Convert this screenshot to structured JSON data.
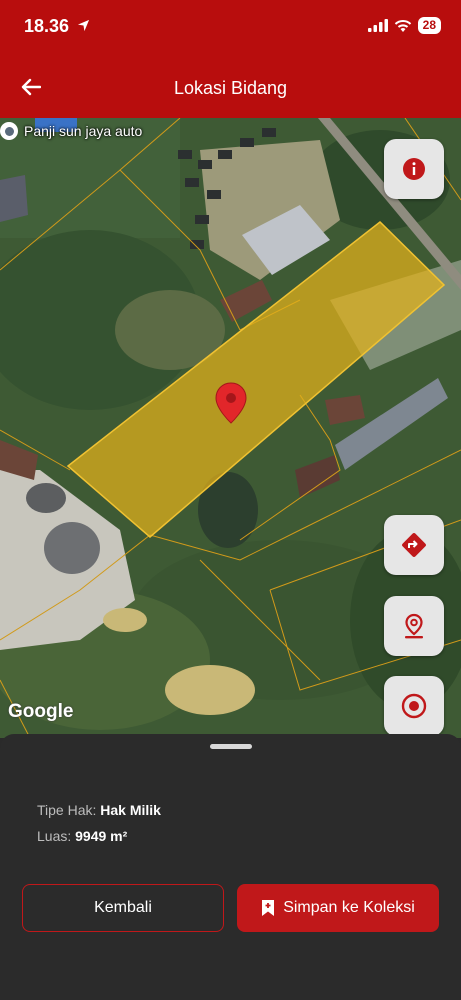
{
  "status": {
    "time": "18.36",
    "battery": "28"
  },
  "header": {
    "title": "Lokasi Bidang"
  },
  "map": {
    "poi_label": "Panji sun jaya auto",
    "attribution": "Google"
  },
  "info": {
    "type_label": "Tipe Hak:",
    "type_value": "Hak Milik",
    "area_label": "Luas:",
    "area_value": "9949 m²"
  },
  "actions": {
    "back_label": "Kembali",
    "save_label": "Simpan ke Koleksi"
  },
  "colors": {
    "brand": "#b80d0d",
    "parcel_fill": "#e3b21a",
    "sheet": "#2b2b2b"
  },
  "icons": [
    "location-arrow-icon",
    "signal-icon",
    "wifi-icon",
    "back-arrow-icon",
    "info-icon",
    "directions-icon",
    "place-pin-icon",
    "target-icon",
    "bookmark-plus-icon",
    "map-marker-icon"
  ]
}
